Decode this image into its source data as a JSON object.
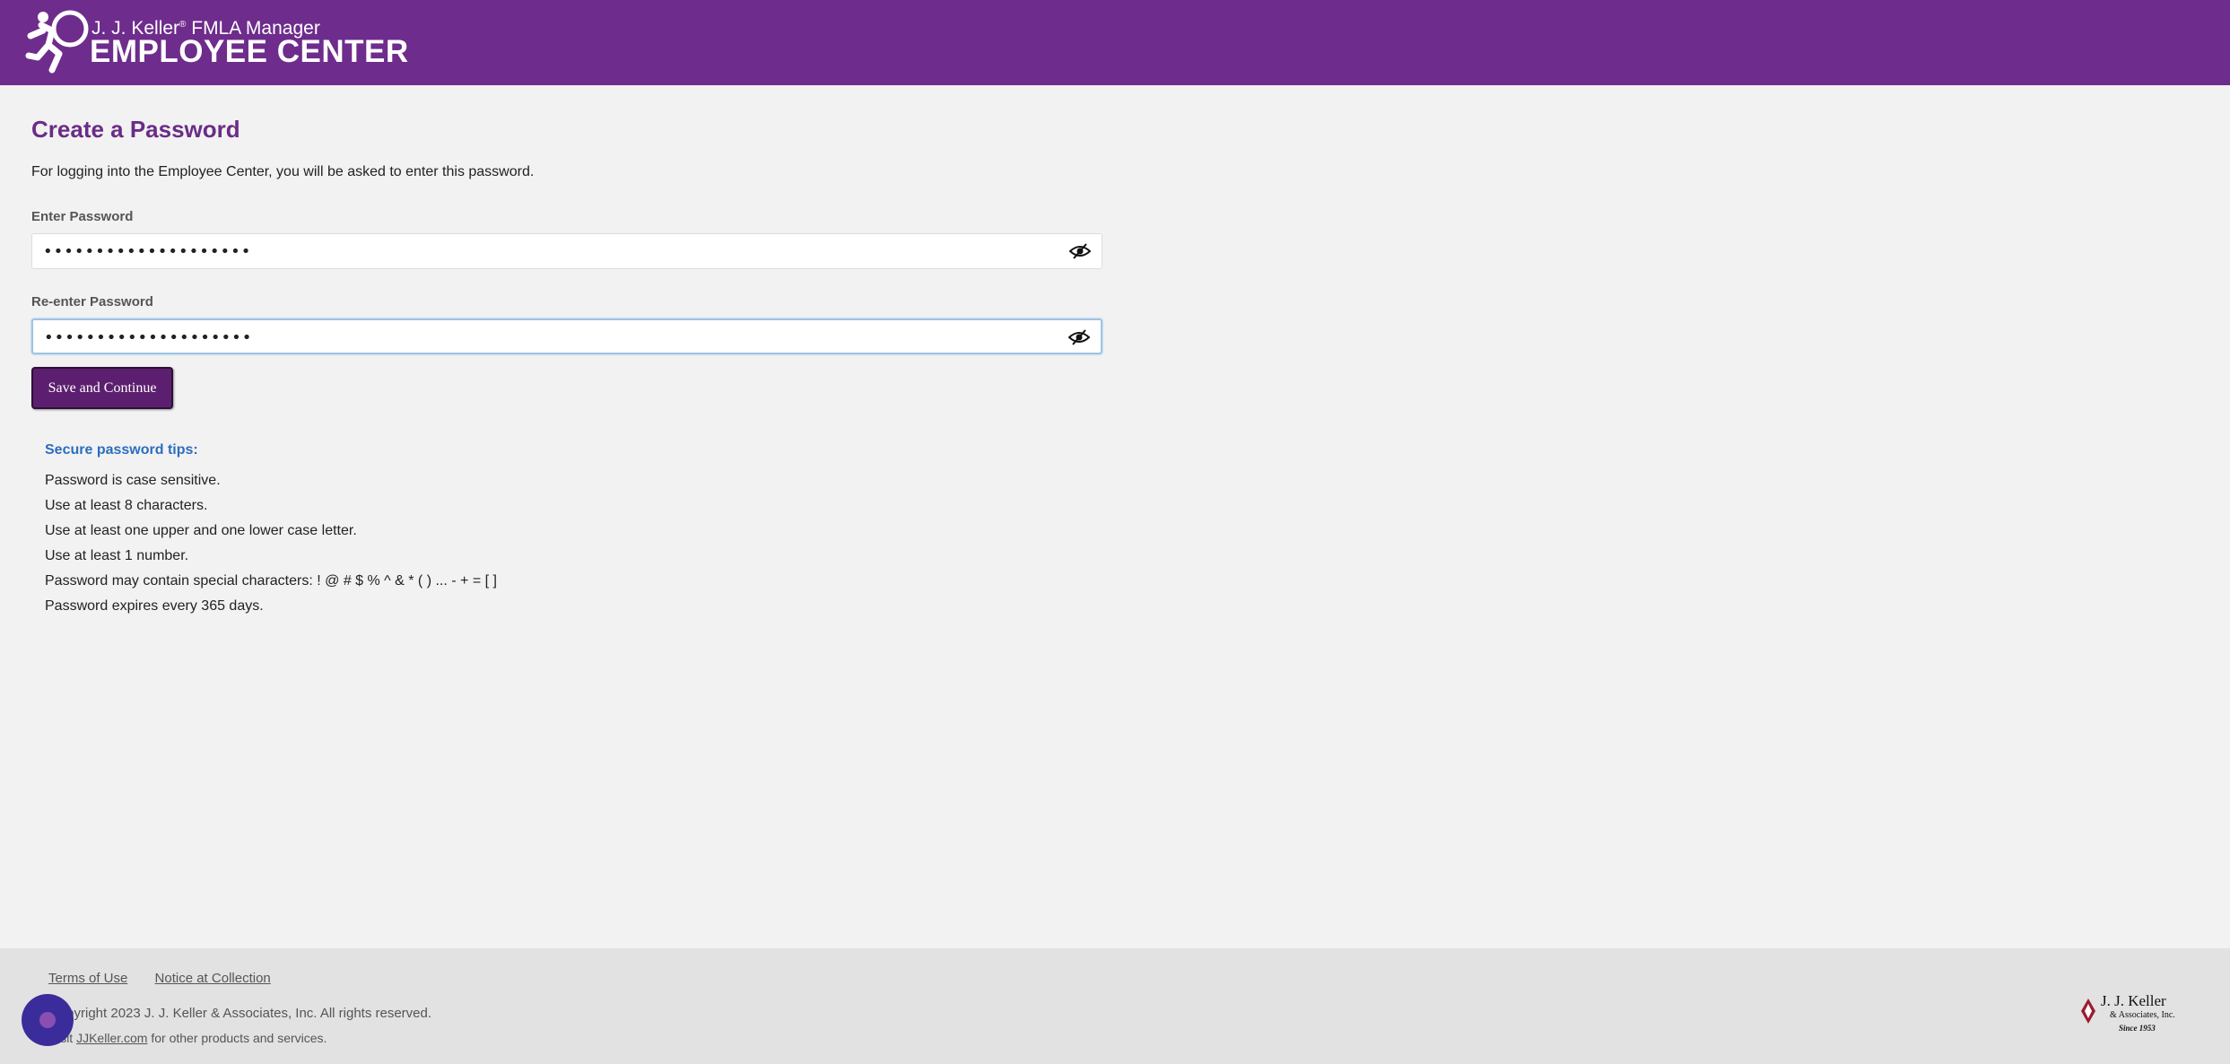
{
  "header": {
    "brand_line1": "J. J. Keller",
    "brand_mark": "®",
    "brand_line1_suffix": " FMLA Manager",
    "brand_line2": "EMPLOYEE CENTER"
  },
  "page": {
    "title": "Create a Password",
    "intro": "For logging into the Employee Center, you will be asked to enter this password."
  },
  "form": {
    "password_label": "Enter Password",
    "password_value": "••••••••••••••••••••",
    "reenter_label": "Re-enter Password",
    "reenter_value": "••••••••••••••••••••",
    "submit_label": "Save and Continue"
  },
  "tips": {
    "title": "Secure password tips:",
    "items": [
      "Password is case sensitive.",
      "Use at least 8 characters.",
      "Use at least one upper and one lower case letter.",
      "Use at least 1 number.",
      "Password may contain special characters: ! @ # $ % ^ & * ( ) ... - + = [ ]",
      "Password expires every 365 days."
    ]
  },
  "footer": {
    "terms_link": "Terms of Use",
    "notice_link": "Notice at Collection",
    "copyright": "Copyright 2023 J. J. Keller & Associates, Inc. All rights reserved.",
    "visit_prefix": "Visit ",
    "visit_link": "JJKeller.com",
    "visit_suffix": " for other products and services.",
    "logo_name": "J. J. Keller",
    "logo_sub": "& Associates, Inc.",
    "logo_since": "Since 1953"
  },
  "colors": {
    "header_bg": "#6e2c8c",
    "title": "#6b2c87",
    "button_bg": "#5c1f6f",
    "tips_title": "#2c6dbf"
  }
}
